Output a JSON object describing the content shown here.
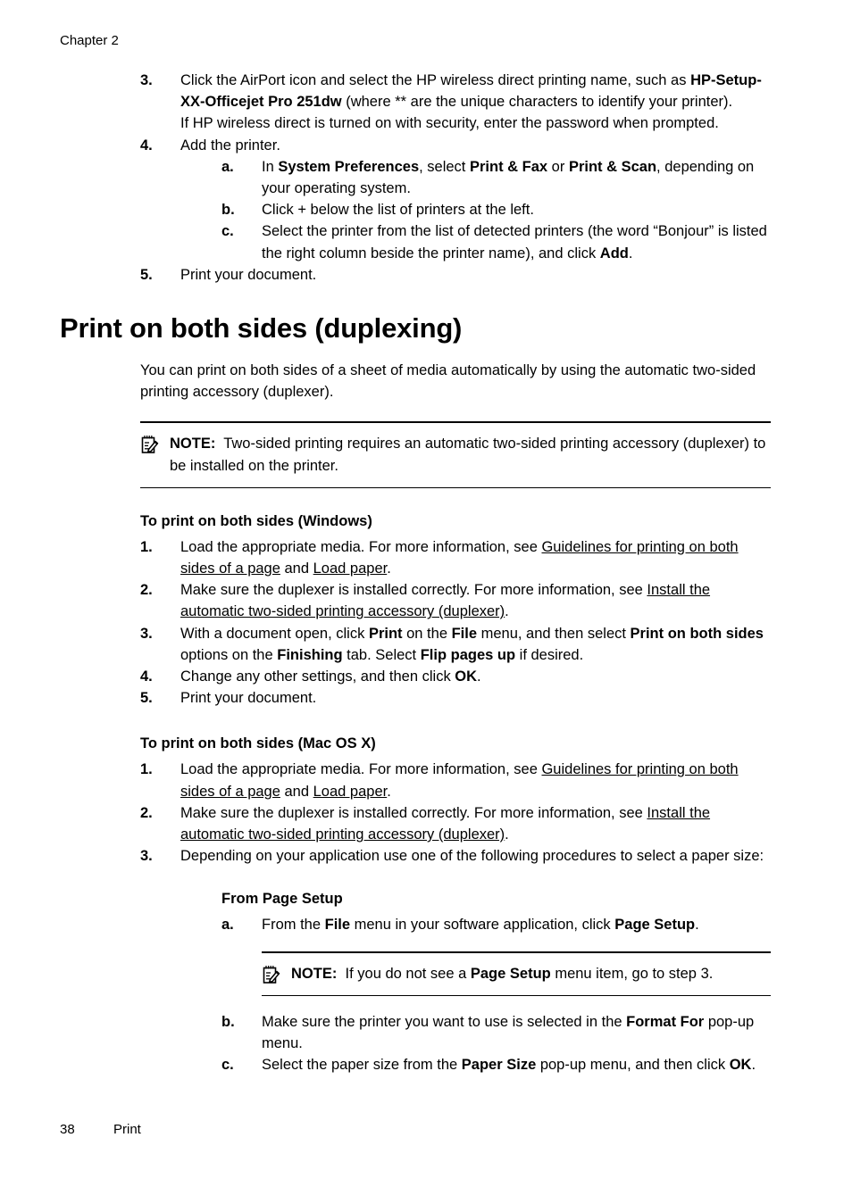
{
  "header": {
    "chapter": "Chapter 2"
  },
  "footer": {
    "page_number": "38",
    "section": "Print"
  },
  "top_steps": [
    {
      "marker": "3.",
      "lines": [
        "Click the AirPort icon and select the HP wireless direct printing name, such as",
        "HP-Setup-XX-Officejet Pro 251dw",
        " (where ** are the unique characters to identify your printer).",
        "If HP wireless direct is turned on with security, enter the password when prompted."
      ]
    },
    {
      "marker": "4.",
      "text": "Add the printer.",
      "substeps": [
        {
          "marker": "a.",
          "parts": [
            "In ",
            "System Preferences",
            ", select ",
            "Print & Fax",
            " or ",
            "Print & Scan",
            ", depending on your operating system."
          ]
        },
        {
          "marker": "b.",
          "parts": [
            "Click + below the list of printers at the left."
          ]
        },
        {
          "marker": "c.",
          "parts": [
            "Select the printer from the list of detected printers (the word “Bonjour” is listed the right column beside the printer name), and click ",
            "Add",
            "."
          ]
        }
      ]
    },
    {
      "marker": "5.",
      "text": "Print your document."
    }
  ],
  "section": {
    "title": "Print on both sides (duplexing)",
    "intro": "You can print on both sides of a sheet of media automatically by using the automatic two-sided printing accessory (duplexer).",
    "note": {
      "icon": "note-pad-pencil-icon",
      "label": "NOTE:",
      "text": "Two-sided printing requires an automatic two-sided printing accessory (duplexer) to be installed on the printer."
    }
  },
  "windows_proc": {
    "heading": "To print on both sides (Windows)",
    "steps": [
      {
        "marker": "1.",
        "p1": "Load the appropriate media. For more information, see ",
        "link1": "Guidelines for printing on both sides of a page",
        "p2": " and ",
        "link2": "Load paper",
        "p3": "."
      },
      {
        "marker": "2.",
        "p1": "Make sure the duplexer is installed correctly. For more information, see ",
        "link1": "Install the automatic two-sided printing accessory (duplexer)",
        "p2": "."
      },
      {
        "marker": "3.",
        "p1": "With a document open, click ",
        "b1": "Print",
        "p2": " on the ",
        "b2": "File",
        "p3": " menu, and then select ",
        "b3": "Print on both sides",
        "p4": " options on the ",
        "b4": "Finishing",
        "p5": " tab. Select ",
        "b5": "Flip pages up",
        "p6": " if desired."
      },
      {
        "marker": "4.",
        "p1": "Change any other settings, and then click ",
        "b1": "OK",
        "p2": "."
      },
      {
        "marker": "5.",
        "p1": "Print your document."
      }
    ]
  },
  "mac_proc": {
    "heading": "To print on both sides (Mac OS X)",
    "steps": [
      {
        "marker": "1.",
        "p1": "Load the appropriate media. For more information, see ",
        "link1": "Guidelines for printing on both sides of a page",
        "p2": " and ",
        "link2": "Load paper",
        "p3": "."
      },
      {
        "marker": "2.",
        "p1": "Make sure the duplexer is installed correctly. For more information, see ",
        "link1": "Install the automatic two-sided printing accessory (duplexer)",
        "p2": "."
      },
      {
        "marker": "3.",
        "p1": "Depending on your application use one of the following procedures to select a paper size:"
      }
    ],
    "page_setup": {
      "heading": "From Page Setup",
      "step_a": {
        "marker": "a.",
        "p1": "From the ",
        "b1": "File",
        "p2": " menu in your software application, click ",
        "b2": "Page Setup",
        "p3": "."
      },
      "note": {
        "icon": "note-pad-pencil-icon",
        "label": "NOTE:",
        "p1": "If you do not see a ",
        "b1": "Page Setup",
        "p2": " menu item, go to step 3."
      },
      "step_b": {
        "marker": "b.",
        "p1": "Make sure the printer you want to use is selected in the ",
        "b1": "Format For",
        "p2": " pop-up menu."
      },
      "step_c": {
        "marker": "c.",
        "p1": "Select the paper size from the ",
        "b1": "Paper Size",
        "p2": " pop-up menu, and then click ",
        "b2": "OK",
        "p3": "."
      }
    }
  }
}
